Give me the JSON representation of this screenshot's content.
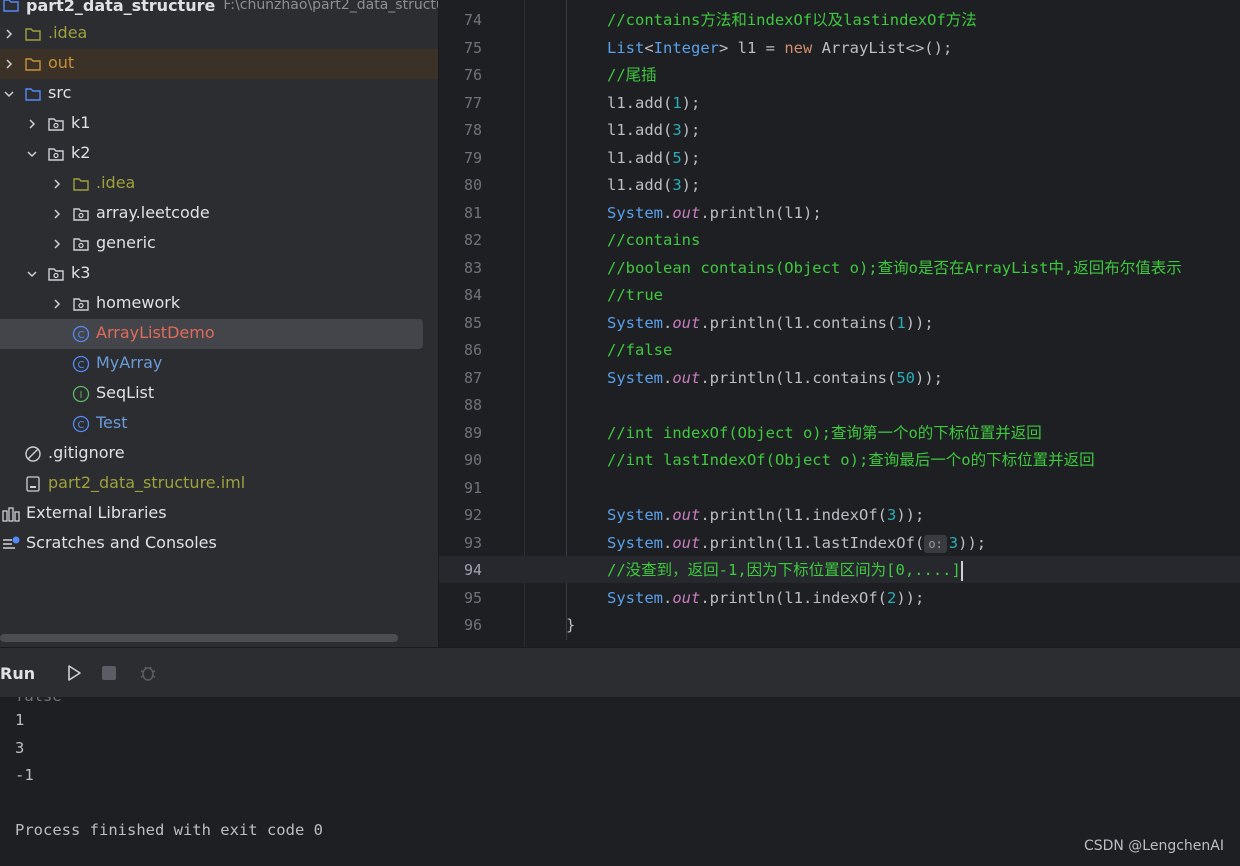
{
  "project": {
    "root_name": "part2_data_structure",
    "root_path": "F:\\chunzhao\\part2_data_structu",
    "items": [
      {
        "label": ".idea",
        "kind": "folder",
        "color": "olive"
      },
      {
        "label": "out",
        "kind": "folder",
        "color": "orange"
      },
      {
        "label": "src",
        "kind": "folder",
        "color": "white"
      },
      {
        "label": "k1",
        "kind": "package",
        "color": "white"
      },
      {
        "label": "k2",
        "kind": "package",
        "color": "white"
      },
      {
        "label": ".idea",
        "kind": "folder",
        "color": "olive"
      },
      {
        "label": "array.leetcode",
        "kind": "package",
        "color": "white"
      },
      {
        "label": "generic",
        "kind": "package",
        "color": "white"
      },
      {
        "label": "k3",
        "kind": "package",
        "color": "white"
      },
      {
        "label": "homework",
        "kind": "package",
        "color": "white"
      },
      {
        "label": "ArrayListDemo",
        "kind": "class",
        "color": "red"
      },
      {
        "label": "MyArray",
        "kind": "class",
        "color": "blue"
      },
      {
        "label": "SeqList",
        "kind": "interface",
        "color": "white"
      },
      {
        "label": "Test",
        "kind": "class",
        "color": "blue"
      },
      {
        "label": ".gitignore",
        "kind": "ignore",
        "color": "white"
      },
      {
        "label": "part2_data_structure.iml",
        "kind": "iml",
        "color": "olive"
      },
      {
        "label": "External Libraries",
        "kind": "libraries",
        "color": "white"
      },
      {
        "label": "Scratches and Consoles",
        "kind": "scratches",
        "color": "white"
      }
    ]
  },
  "editor": {
    "lines": [
      {
        "n": "74",
        "segs": [
          [
            "cmt",
            "//contains方法和indexOf以及lastindexOf方法"
          ]
        ]
      },
      {
        "n": "75",
        "segs": [
          [
            "cls",
            "List"
          ],
          [
            "def",
            "<"
          ],
          [
            "cls",
            "Integer"
          ],
          [
            "def",
            "> l1 = "
          ],
          [
            "kw",
            "new "
          ],
          [
            "def",
            "ArrayList<>();"
          ]
        ]
      },
      {
        "n": "76",
        "segs": [
          [
            "cmt",
            "//尾插"
          ]
        ]
      },
      {
        "n": "77",
        "segs": [
          [
            "def",
            "l1.add("
          ],
          [
            "num",
            "1"
          ],
          [
            "def",
            ");"
          ]
        ]
      },
      {
        "n": "78",
        "segs": [
          [
            "def",
            "l1.add("
          ],
          [
            "num",
            "3"
          ],
          [
            "def",
            ");"
          ]
        ]
      },
      {
        "n": "79",
        "segs": [
          [
            "def",
            "l1.add("
          ],
          [
            "num",
            "5"
          ],
          [
            "def",
            ");"
          ]
        ]
      },
      {
        "n": "80",
        "segs": [
          [
            "def",
            "l1.add("
          ],
          [
            "num",
            "3"
          ],
          [
            "def",
            ");"
          ]
        ]
      },
      {
        "n": "81",
        "segs": [
          [
            "cls",
            "System"
          ],
          [
            "def",
            "."
          ],
          [
            "fld",
            "out"
          ],
          [
            "def",
            ".println(l1);"
          ]
        ]
      },
      {
        "n": "82",
        "segs": [
          [
            "cmt",
            "//contains"
          ]
        ]
      },
      {
        "n": "83",
        "segs": [
          [
            "cmt",
            "//boolean contains(Object o);查询o是否在ArrayList中,返回布尔值表示"
          ]
        ]
      },
      {
        "n": "84",
        "segs": [
          [
            "cmt",
            "//true"
          ]
        ]
      },
      {
        "n": "85",
        "segs": [
          [
            "cls",
            "System"
          ],
          [
            "def",
            "."
          ],
          [
            "fld",
            "out"
          ],
          [
            "def",
            ".println(l1.contains("
          ],
          [
            "num",
            "1"
          ],
          [
            "def",
            "));"
          ]
        ]
      },
      {
        "n": "86",
        "segs": [
          [
            "cmt",
            "//false"
          ]
        ]
      },
      {
        "n": "87",
        "segs": [
          [
            "cls",
            "System"
          ],
          [
            "def",
            "."
          ],
          [
            "fld",
            "out"
          ],
          [
            "def",
            ".println(l1.contains("
          ],
          [
            "num",
            "50"
          ],
          [
            "def",
            "));"
          ]
        ]
      },
      {
        "n": "88",
        "segs": []
      },
      {
        "n": "89",
        "segs": [
          [
            "cmt",
            "//int indexOf(Object o);查询第一个o的下标位置并返回"
          ]
        ]
      },
      {
        "n": "90",
        "segs": [
          [
            "cmt",
            "//int lastIndexOf(Object o);查询最后一个o的下标位置并返回"
          ]
        ]
      },
      {
        "n": "91",
        "segs": []
      },
      {
        "n": "92",
        "segs": [
          [
            "cls",
            "System"
          ],
          [
            "def",
            "."
          ],
          [
            "fld",
            "out"
          ],
          [
            "def",
            ".println(l1.indexOf("
          ],
          [
            "num",
            "3"
          ],
          [
            "def",
            "));"
          ]
        ]
      },
      {
        "n": "93",
        "segs": [
          [
            "cls",
            "System"
          ],
          [
            "def",
            "."
          ],
          [
            "fld",
            "out"
          ],
          [
            "def",
            ".println(l1.lastIndexOf("
          ],
          [
            "hint",
            "o:"
          ],
          [
            "num",
            "3"
          ],
          [
            "def",
            "));"
          ]
        ]
      },
      {
        "n": "94",
        "segs": [
          [
            "cmt",
            "//没查到，返回-1,因为下标位置区间为[0,....]"
          ]
        ],
        "current": true
      },
      {
        "n": "95",
        "segs": [
          [
            "cls",
            "System"
          ],
          [
            "def",
            "."
          ],
          [
            "fld",
            "out"
          ],
          [
            "def",
            ".println(l1.indexOf("
          ],
          [
            "num",
            "2"
          ],
          [
            "def",
            "));"
          ]
        ]
      },
      {
        "n": "96",
        "segs": [
          [
            "def",
            "}"
          ]
        ],
        "indent": "outer"
      }
    ]
  },
  "run": {
    "title": "Run",
    "output": [
      "1",
      "3",
      "-1",
      "",
      "Process finished with exit code 0"
    ]
  },
  "watermark": "CSDN @LengchenAI",
  "colors": {
    "accent_blue": "#548af7",
    "comment_green": "#3ec93e",
    "class_blue": "#5aa0e8"
  }
}
